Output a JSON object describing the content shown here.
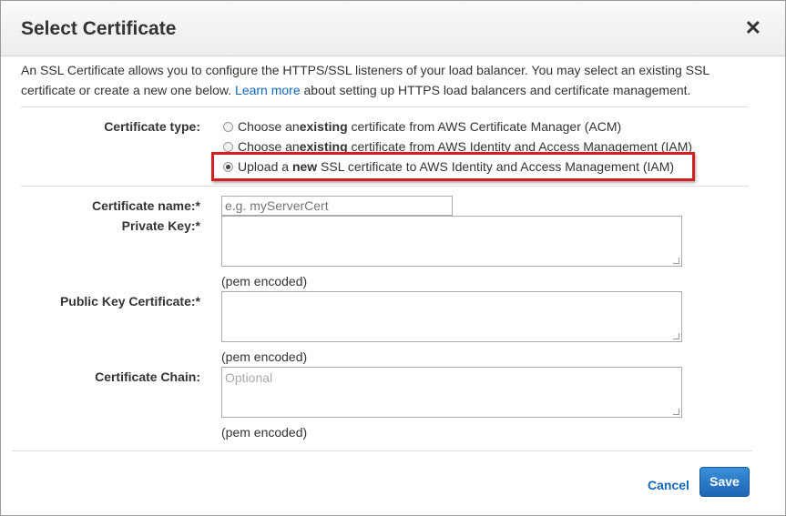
{
  "dialog": {
    "title": "Select Certificate",
    "close_glyph": "✕"
  },
  "intro": {
    "text_before": "An SSL Certificate allows you to configure the HTTPS/SSL listeners of your load balancer. You may select an existing SSL certificate or create a new one below.",
    "link": "Learn more",
    "text_after": "about setting up HTTPS load balancers and certificate management."
  },
  "certificate_type": {
    "label": "Certificate type:",
    "options": [
      {
        "pre": "Choose an ",
        "bold": "existing",
        "post": " certificate from AWS Certificate Manager (ACM)",
        "selected": false
      },
      {
        "pre": "Choose an ",
        "bold": "existing",
        "post": " certificate from AWS Identity and Access Management (IAM)",
        "selected": false
      },
      {
        "pre": "Upload a ",
        "bold": "new",
        "post": " SSL certificate to AWS Identity and Access Management (IAM)",
        "selected": true
      }
    ]
  },
  "fields": {
    "certificate_name": {
      "label": "Certificate name:*",
      "placeholder": "e.g. myServerCert",
      "value": ""
    },
    "private_key": {
      "label": "Private Key:*",
      "hint": "(pem encoded)",
      "value": ""
    },
    "public_key_certificate": {
      "label": "Public Key Certificate:*",
      "hint": "(pem encoded)",
      "value": ""
    },
    "certificate_chain": {
      "label": "Certificate Chain:",
      "placeholder": "Optional",
      "hint": "(pem encoded)",
      "value": ""
    }
  },
  "footer": {
    "cancel_label": "Cancel",
    "save_label": "Save"
  },
  "colors": {
    "link": "#1166bb",
    "primary_button": "#1e66b5",
    "highlight_border": "#d31f1f"
  },
  "icons": {
    "close": "close-icon"
  }
}
